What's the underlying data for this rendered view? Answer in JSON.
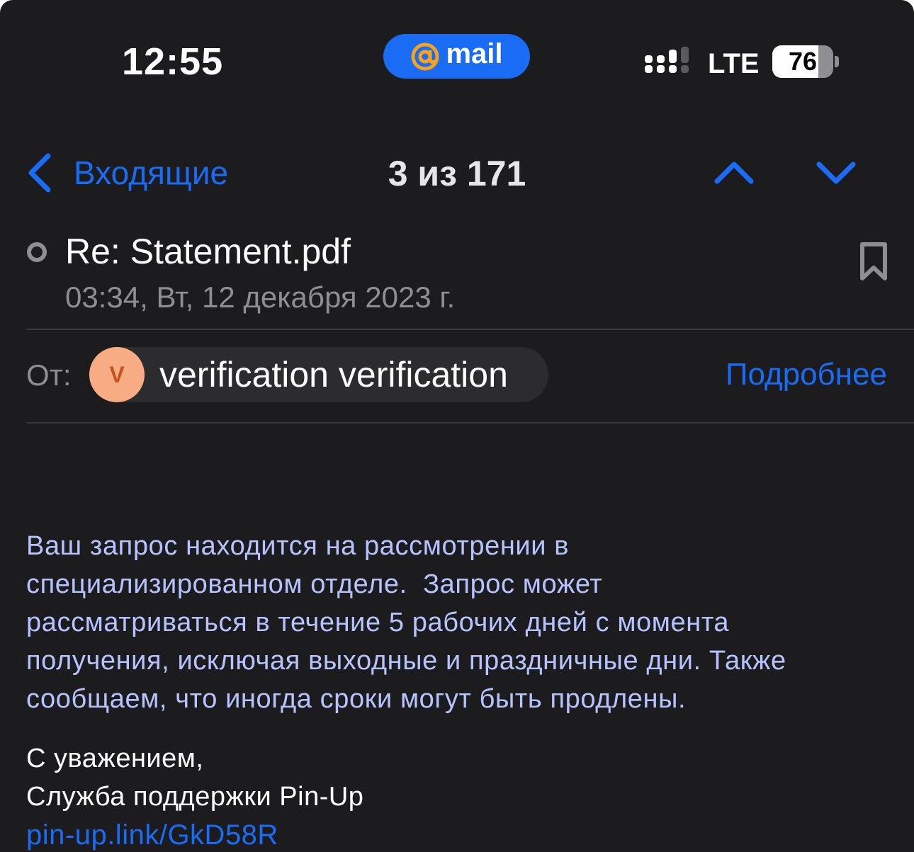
{
  "status_bar": {
    "time": "12:55",
    "app_badge": "mail",
    "app_badge_icon": "at-icon",
    "network": "LTE",
    "battery_percent": 76,
    "battery_label": "76"
  },
  "nav": {
    "back_label": "Входящие",
    "counter": "3 из 171",
    "up_icon": "chevron-up-icon",
    "down_icon": "chevron-down-icon"
  },
  "message": {
    "subject": "Re: Statement.pdf",
    "date": "03:34, Вт, 12 декабря 2023 г.",
    "from_label": "От:",
    "sender_initial": "V",
    "sender_name": "verification verification",
    "details_label": "Подробнее",
    "body_lines": [
      "Ваш запрос находится на рассмотрении в",
      "специализированном отделе.  Запрос может",
      "рассматриваться в течение 5 рабочих дней с момента",
      "получения, исключая выходные и праздничные дни. Также",
      "сообщаем, что иногда сроки могут быть продлены."
    ],
    "signature": {
      "greeting": "С уважением,",
      "team": "Служба поддержки Pin-Up",
      "link": "pin-up.link/GkD58R"
    }
  },
  "colors": {
    "background": "#1c1c1e",
    "accent": "#1a6cf5",
    "body_text": "#b7c3ff",
    "secondary_text": "#8e8e93",
    "avatar_bg": "#f8ac84",
    "avatar_text": "#c4531c"
  }
}
